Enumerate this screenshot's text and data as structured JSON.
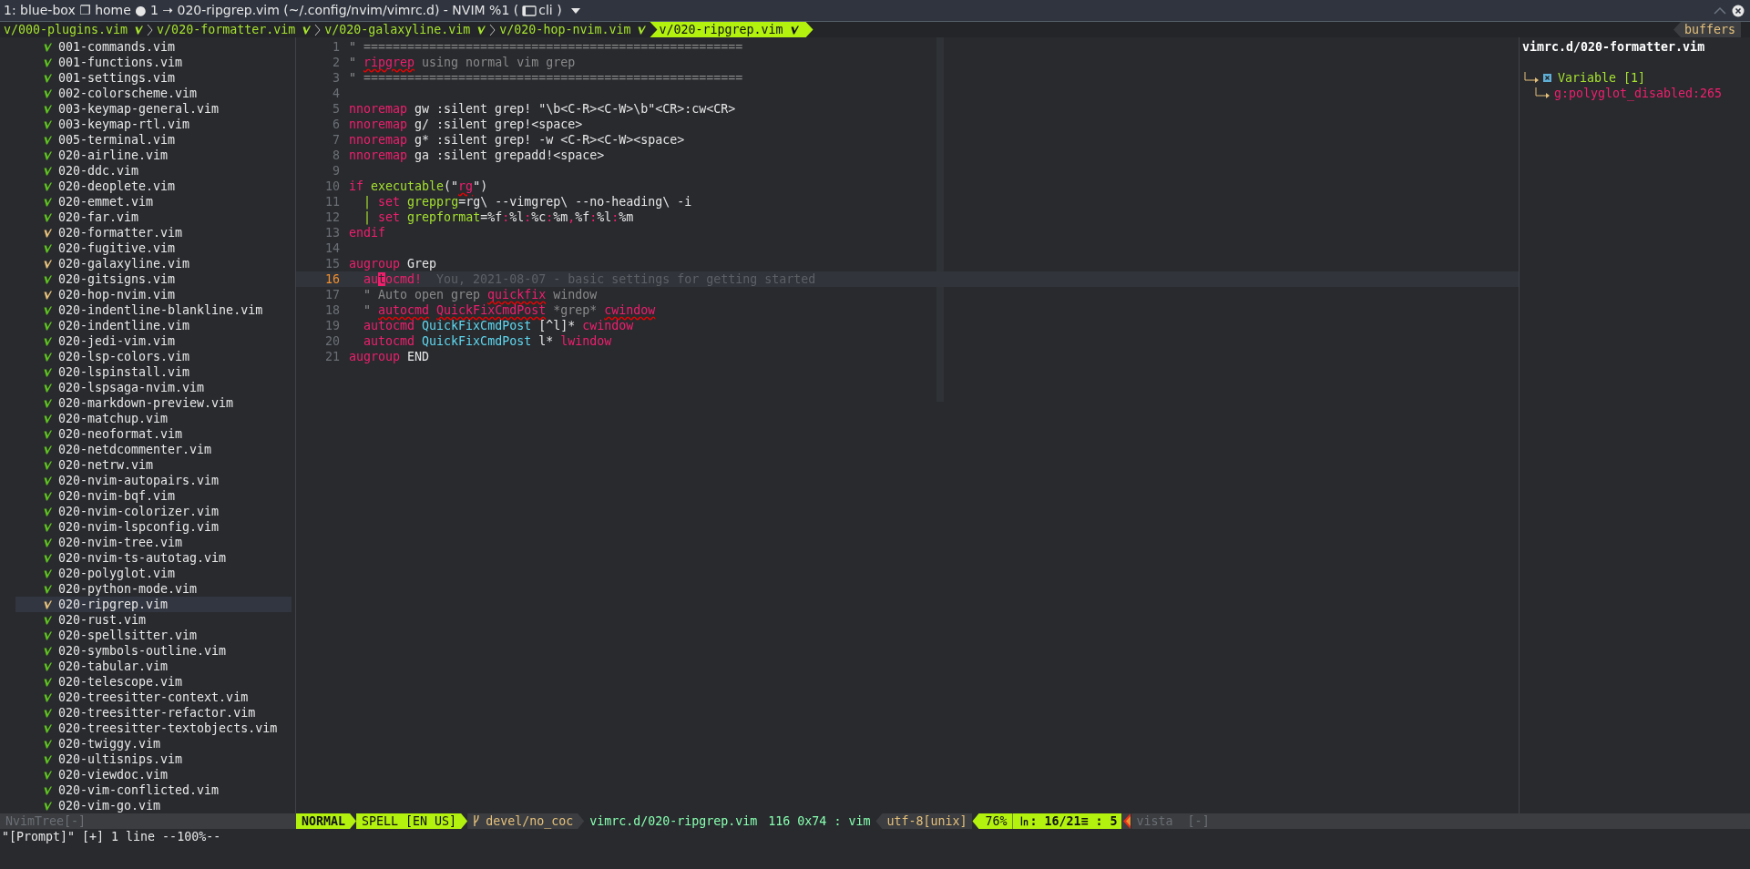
{
  "window": {
    "title": "1: blue-box ❐ home ● 1 ➝ 020-ripgrep.vim (~/.config/nvim/vimrc.d) - NVIM %1 (",
    "title_suffix": "cli )"
  },
  "tabs": [
    {
      "label": "v/000-plugins.vim",
      "selected": false
    },
    {
      "label": "v/020-formatter.vim",
      "selected": false
    },
    {
      "label": "v/020-galaxyline.vim",
      "selected": false
    },
    {
      "label": "v/020-hop-nvim.vim",
      "selected": false
    },
    {
      "label": "v/020-ripgrep.vim",
      "selected": true
    }
  ],
  "buffers_label": "buffers",
  "file_tree": [
    {
      "name": "001-commands.vim",
      "modified": false,
      "selected": false
    },
    {
      "name": "001-functions.vim",
      "modified": false,
      "selected": false
    },
    {
      "name": "001-settings.vim",
      "modified": false,
      "selected": false
    },
    {
      "name": "002-colorscheme.vim",
      "modified": false,
      "selected": false
    },
    {
      "name": "003-keymap-general.vim",
      "modified": false,
      "selected": false
    },
    {
      "name": "003-keymap-rtl.vim",
      "modified": false,
      "selected": false
    },
    {
      "name": "005-terminal.vim",
      "modified": false,
      "selected": false
    },
    {
      "name": "020-airline.vim",
      "modified": false,
      "selected": false
    },
    {
      "name": "020-ddc.vim",
      "modified": false,
      "selected": false
    },
    {
      "name": "020-deoplete.vim",
      "modified": false,
      "selected": false
    },
    {
      "name": "020-emmet.vim",
      "modified": false,
      "selected": false
    },
    {
      "name": "020-far.vim",
      "modified": false,
      "selected": false
    },
    {
      "name": "020-formatter.vim",
      "modified": true,
      "selected": false
    },
    {
      "name": "020-fugitive.vim",
      "modified": false,
      "selected": false
    },
    {
      "name": "020-galaxyline.vim",
      "modified": true,
      "selected": false
    },
    {
      "name": "020-gitsigns.vim",
      "modified": false,
      "selected": false
    },
    {
      "name": "020-hop-nvim.vim",
      "modified": true,
      "selected": false
    },
    {
      "name": "020-indentline-blankline.vim",
      "modified": false,
      "selected": false
    },
    {
      "name": "020-indentline.vim",
      "modified": false,
      "selected": false
    },
    {
      "name": "020-jedi-vim.vim",
      "modified": false,
      "selected": false
    },
    {
      "name": "020-lsp-colors.vim",
      "modified": false,
      "selected": false
    },
    {
      "name": "020-lspinstall.vim",
      "modified": false,
      "selected": false
    },
    {
      "name": "020-lspsaga-nvim.vim",
      "modified": false,
      "selected": false
    },
    {
      "name": "020-markdown-preview.vim",
      "modified": false,
      "selected": false
    },
    {
      "name": "020-matchup.vim",
      "modified": false,
      "selected": false
    },
    {
      "name": "020-neoformat.vim",
      "modified": false,
      "selected": false
    },
    {
      "name": "020-netdcommenter.vim",
      "modified": false,
      "selected": false
    },
    {
      "name": "020-netrw.vim",
      "modified": false,
      "selected": false
    },
    {
      "name": "020-nvim-autopairs.vim",
      "modified": false,
      "selected": false
    },
    {
      "name": "020-nvim-bqf.vim",
      "modified": false,
      "selected": false
    },
    {
      "name": "020-nvim-colorizer.vim",
      "modified": false,
      "selected": false
    },
    {
      "name": "020-nvim-lspconfig.vim",
      "modified": false,
      "selected": false
    },
    {
      "name": "020-nvim-tree.vim",
      "modified": false,
      "selected": false
    },
    {
      "name": "020-nvim-ts-autotag.vim",
      "modified": false,
      "selected": false
    },
    {
      "name": "020-polyglot.vim",
      "modified": false,
      "selected": false
    },
    {
      "name": "020-python-mode.vim",
      "modified": false,
      "selected": false
    },
    {
      "name": "020-ripgrep.vim",
      "modified": true,
      "selected": true
    },
    {
      "name": "020-rust.vim",
      "modified": false,
      "selected": false
    },
    {
      "name": "020-spellsitter.vim",
      "modified": false,
      "selected": false
    },
    {
      "name": "020-symbols-outline.vim",
      "modified": false,
      "selected": false
    },
    {
      "name": "020-tabular.vim",
      "modified": false,
      "selected": false
    },
    {
      "name": "020-telescope.vim",
      "modified": false,
      "selected": false
    },
    {
      "name": "020-treesitter-context.vim",
      "modified": false,
      "selected": false
    },
    {
      "name": "020-treesitter-refactor.vim",
      "modified": false,
      "selected": false
    },
    {
      "name": "020-treesitter-textobjects.vim",
      "modified": false,
      "selected": false
    },
    {
      "name": "020-twiggy.vim",
      "modified": false,
      "selected": false
    },
    {
      "name": "020-ultisnips.vim",
      "modified": false,
      "selected": false
    },
    {
      "name": "020-viewdoc.vim",
      "modified": false,
      "selected": false
    },
    {
      "name": "020-vim-conflicted.vim",
      "modified": false,
      "selected": false
    },
    {
      "name": "020-vim-go.vim",
      "modified": false,
      "selected": false
    }
  ],
  "code_lines": [
    {
      "number": "1",
      "current": false,
      "segments": [
        {
          "kind": "comment",
          "text": "\" ===================================================="
        }
      ]
    },
    {
      "number": "2",
      "current": false,
      "segments": [
        {
          "kind": "comment",
          "text": "\" "
        },
        {
          "kind": "spell",
          "text": "ripgrep"
        },
        {
          "kind": "comment",
          "text": " using normal vim grep"
        }
      ]
    },
    {
      "number": "3",
      "current": false,
      "segments": [
        {
          "kind": "comment",
          "text": "\" ===================================================="
        }
      ]
    },
    {
      "number": "4",
      "current": false
    },
    {
      "number": "5",
      "current": false,
      "segments": [
        {
          "kind": "keyword",
          "text": "nnoremap"
        },
        {
          "kind": "plain",
          "text": " gw :silent grep! \"\\b<C-R><C-W>\\b\"<CR>:cw<CR>"
        }
      ]
    },
    {
      "number": "6",
      "current": false,
      "segments": [
        {
          "kind": "keyword",
          "text": "nnoremap"
        },
        {
          "kind": "plain",
          "text": " g/ :silent grep!<space>"
        }
      ]
    },
    {
      "number": "7",
      "current": false,
      "segments": [
        {
          "kind": "keyword",
          "text": "nnoremap"
        },
        {
          "kind": "plain",
          "text": " g* :silent grep! -w <C-R><C-W><space>"
        }
      ]
    },
    {
      "number": "8",
      "current": false,
      "segments": [
        {
          "kind": "keyword",
          "text": "nnoremap"
        },
        {
          "kind": "plain",
          "text": " ga :silent grepadd!<space>"
        }
      ]
    },
    {
      "number": "9",
      "current": false
    },
    {
      "number": "10",
      "current": false,
      "segments": [
        {
          "kind": "keyword",
          "text": "if"
        },
        {
          "kind": "function",
          "text": " executable"
        },
        {
          "kind": "plain",
          "text": "(\""
        },
        {
          "kind": "spell",
          "text": "rg"
        },
        {
          "kind": "plain",
          "text": "\")"
        }
      ]
    },
    {
      "number": "11",
      "current": false,
      "segments": [
        {
          "kind": "function",
          "text": "  |"
        },
        {
          "kind": "keyword",
          "text": " set"
        },
        {
          "kind": "function",
          "text": " grepprg"
        },
        {
          "kind": "plain",
          "text": "=rg\\ --vimgrep\\ --no-heading\\ -i"
        }
      ]
    },
    {
      "number": "12",
      "current": false,
      "segments": [
        {
          "kind": "function",
          "text": "  |"
        },
        {
          "kind": "keyword",
          "text": " set"
        },
        {
          "kind": "function",
          "text": " grepformat"
        },
        {
          "kind": "plain",
          "text": "=%f"
        },
        {
          "kind": "keyword",
          "text": ":"
        },
        {
          "kind": "plain",
          "text": "%l"
        },
        {
          "kind": "keyword",
          "text": ":"
        },
        {
          "kind": "plain",
          "text": "%c"
        },
        {
          "kind": "keyword",
          "text": ":"
        },
        {
          "kind": "plain",
          "text": "%m"
        },
        {
          "kind": "keyword",
          "text": ","
        },
        {
          "kind": "plain",
          "text": "%f"
        },
        {
          "kind": "keyword",
          "text": ":"
        },
        {
          "kind": "plain",
          "text": "%l"
        },
        {
          "kind": "keyword",
          "text": ":"
        },
        {
          "kind": "plain",
          "text": "%m"
        }
      ]
    },
    {
      "number": "13",
      "current": false,
      "segments": [
        {
          "kind": "keyword",
          "text": "endif"
        }
      ]
    },
    {
      "number": "14",
      "current": false
    },
    {
      "number": "15",
      "current": false,
      "segments": [
        {
          "kind": "keyword",
          "text": "augroup"
        },
        {
          "kind": "plain",
          "text": " Grep"
        }
      ]
    },
    {
      "number": "16",
      "current": true,
      "segments": [
        {
          "kind": "keyword",
          "text": "  au"
        },
        {
          "kind": "cursor",
          "text": "t"
        },
        {
          "kind": "keyword",
          "text": "ocmd!"
        }
      ],
      "virtual_text": "You, 2021-08-07 - basic settings for getting started"
    },
    {
      "number": "17",
      "current": false,
      "segments": [
        {
          "kind": "comment",
          "text": "  \" Auto open grep "
        },
        {
          "kind": "spell",
          "text": "quickfix"
        },
        {
          "kind": "comment",
          "text": " window"
        }
      ]
    },
    {
      "number": "18",
      "current": false,
      "segments": [
        {
          "kind": "comment",
          "text": "  \" "
        },
        {
          "kind": "spell",
          "text": "autocmd"
        },
        {
          "kind": "spell",
          "text": " QuickFixCmdPost"
        },
        {
          "kind": "comment",
          "text": " *grep* "
        },
        {
          "kind": "spell",
          "text": "cwindow"
        }
      ]
    },
    {
      "number": "19",
      "current": false,
      "segments": [
        {
          "kind": "keyword",
          "text": "  autocmd"
        },
        {
          "kind": "type",
          "text": " QuickFixCmdPost"
        },
        {
          "kind": "plain",
          "text": " [^l]* "
        },
        {
          "kind": "keyword",
          "text": "cwindow"
        }
      ]
    },
    {
      "number": "20",
      "current": false,
      "segments": [
        {
          "kind": "keyword",
          "text": "  autocmd"
        },
        {
          "kind": "type",
          "text": " QuickFixCmdPost"
        },
        {
          "kind": "plain",
          "text": " l* "
        },
        {
          "kind": "keyword",
          "text": "lwindow"
        }
      ]
    },
    {
      "number": "21",
      "current": false,
      "segments": [
        {
          "kind": "keyword",
          "text": "augroup"
        },
        {
          "kind": "plain",
          "text": " END"
        }
      ]
    }
  ],
  "outline": {
    "title": "vimrc.d/020-formatter.vim",
    "items": [
      {
        "label": "Variable [1]",
        "children": [
          {
            "label": "g:polyglot_disabled:265"
          }
        ]
      }
    ]
  },
  "status_bar": {
    "tree_label": "NvimTree[-]",
    "segments": [
      {
        "kind": "mode",
        "text": "NORMAL"
      },
      {
        "kind": "spell",
        "text": "SPELL [EN US]"
      },
      {
        "kind": "branch",
        "text": "devel/no_coc"
      },
      {
        "kind": "file",
        "text": "vimrc.d/020-ripgrep.vim"
      },
      {
        "kind": "info",
        "text": "116 0x74 : vim"
      },
      {
        "kind": "encoding",
        "text": "utf-8[unix]"
      },
      {
        "kind": "percent",
        "text": "76%"
      },
      {
        "kind": "position",
        "text": "㏑: 16/21≡ : 5"
      }
    ],
    "outline_label": "vista  [-]"
  },
  "command_line": "\"[Prompt]\" [+] 1 line --100%--"
}
